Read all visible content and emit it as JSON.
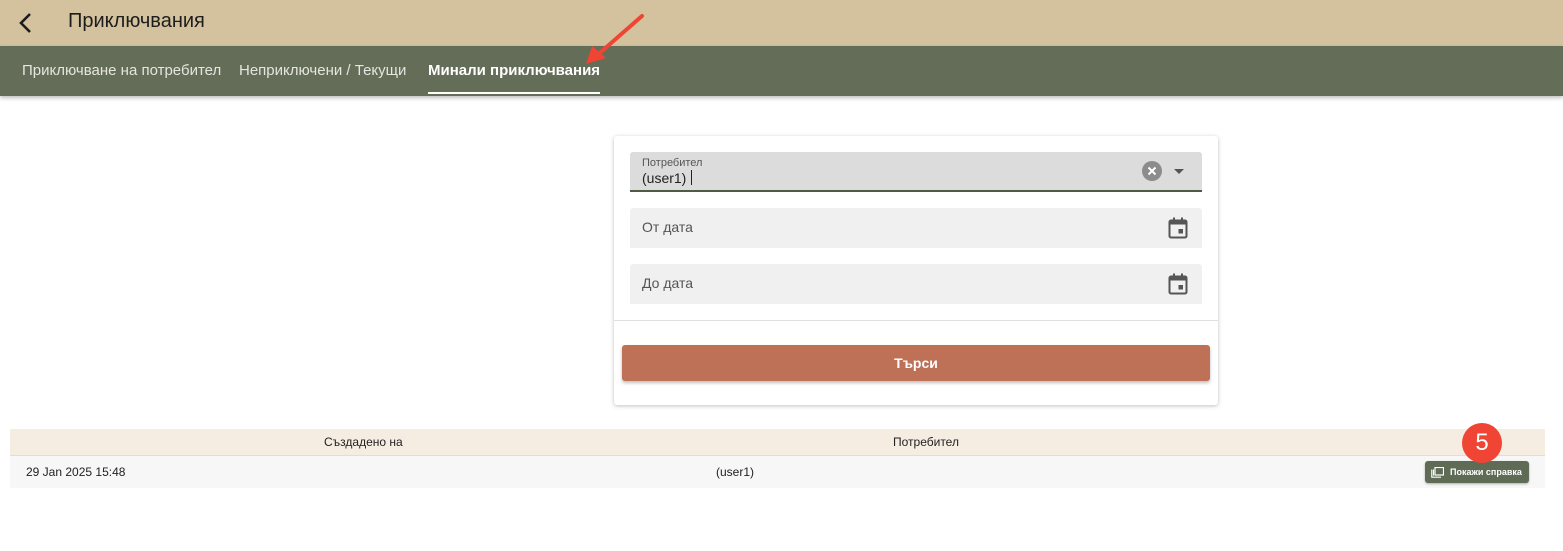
{
  "header": {
    "title": "Приключвания",
    "back_icon": "chevron-left-icon"
  },
  "tabs": [
    {
      "label": "Приключване на потребител",
      "active": false
    },
    {
      "label": "Неприключени / Текущи",
      "active": false
    },
    {
      "label": "Минали приключвания",
      "active": true
    }
  ],
  "form": {
    "user_field": {
      "label": "Потребител",
      "value": "(user1)"
    },
    "from_date": {
      "placeholder": "От дата"
    },
    "to_date": {
      "placeholder": "До дата"
    },
    "search_label": "Търси"
  },
  "table": {
    "columns": [
      "Създадено на",
      "Потребител"
    ],
    "rows": [
      {
        "created": "29 Jan 2025 15:48",
        "user": "(user1)",
        "action": "Покажи справка"
      }
    ]
  },
  "annotations": {
    "step_number": "5"
  },
  "colors": {
    "header_bg": "#d3c29d",
    "tabbar_bg": "#636d57",
    "accent_button": "#bf7158",
    "report_button": "#5f6b55",
    "badge": "#f04434"
  }
}
